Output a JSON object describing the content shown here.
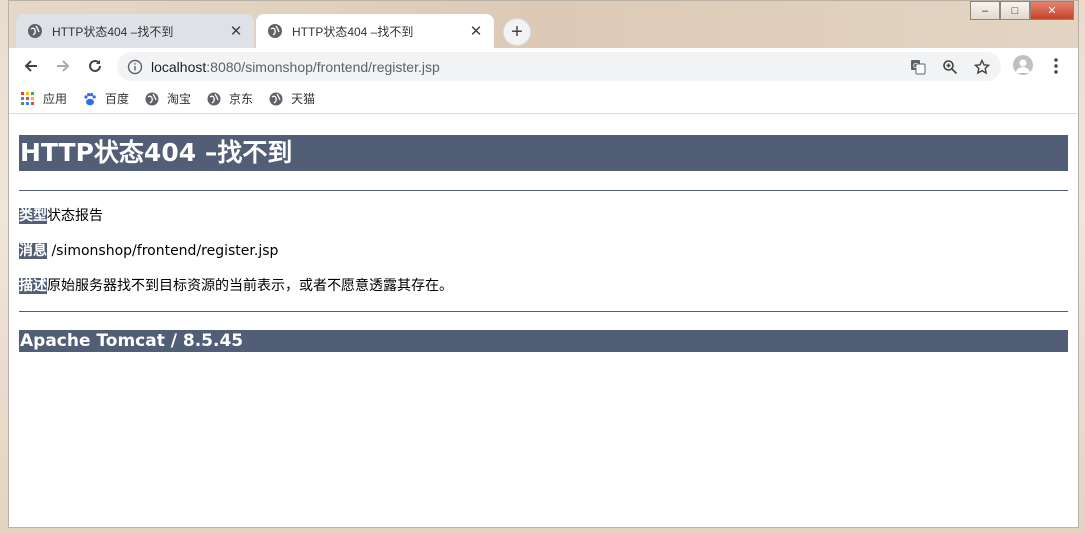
{
  "window": {
    "minimize": "–",
    "maximize": "□",
    "close": "✕"
  },
  "tabs": [
    {
      "title": "HTTP状态404 –找不到",
      "close": "✕",
      "active": false
    },
    {
      "title": "HTTP状态404 –找不到",
      "close": "✕",
      "active": true
    }
  ],
  "newtab_label": "+",
  "address": {
    "host": "localhost",
    "rest": ":8080/simonshop/frontend/register.jsp"
  },
  "toolbar_icons": [
    "back-icon",
    "forward-icon",
    "reload-icon",
    "info-icon",
    "translate-icon",
    "zoom-icon",
    "star-icon",
    "profile-icon",
    "menu-icon"
  ],
  "bookmarks": [
    {
      "label": "应用",
      "icon": "apps-grid-icon"
    },
    {
      "label": "百度",
      "icon": "baidu-paw-icon"
    },
    {
      "label": "淘宝",
      "icon": "globe-icon"
    },
    {
      "label": "京东",
      "icon": "globe-icon"
    },
    {
      "label": "天猫",
      "icon": "globe-icon"
    }
  ],
  "page": {
    "heading": "HTTP状态404 –找不到",
    "type_label": "类型",
    "type_value": "状态报告",
    "message_label": "消息",
    "message_value": " /simonshop/frontend/register.jsp",
    "desc_label": "描述",
    "desc_value": "原始服务器找不到目标资源的当前表示，或者不愿意透露其存在。",
    "footer": "Apache Tomcat / 8.5.45"
  },
  "colors": {
    "tomcat_bar": "#525d76"
  }
}
